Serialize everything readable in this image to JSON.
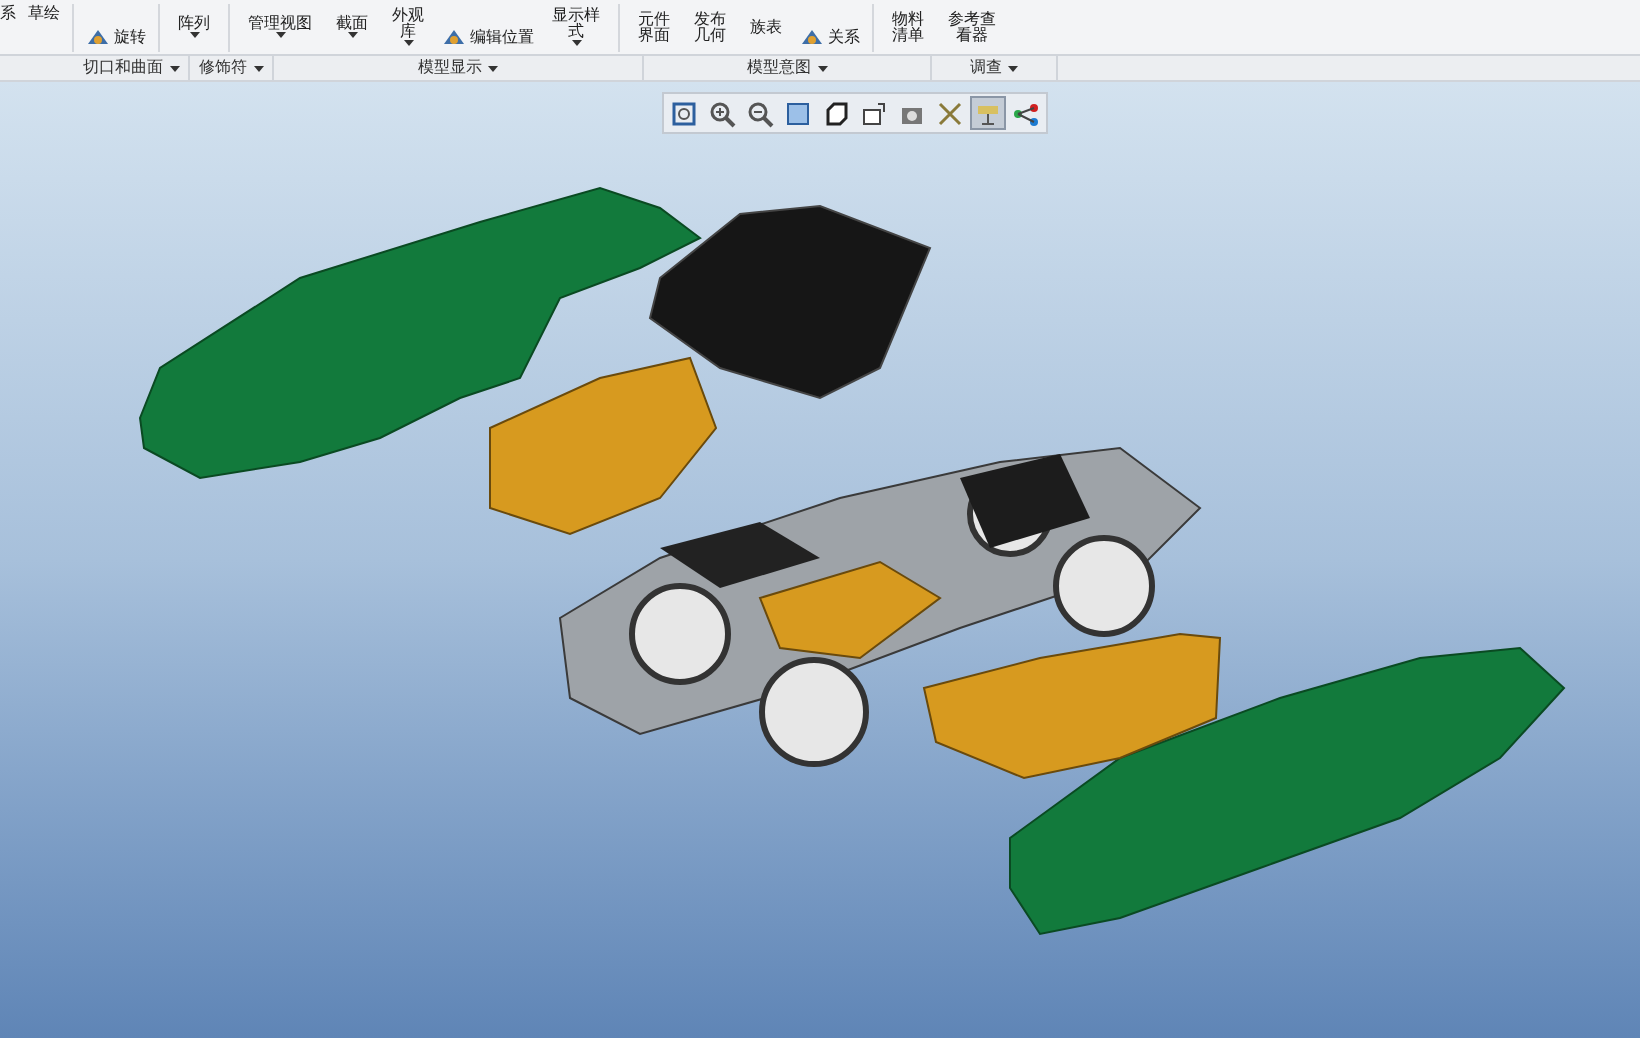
{
  "ribbon": {
    "items": [
      {
        "kind": "small",
        "label": "系",
        "dropdown": false
      },
      {
        "kind": "small",
        "label": "草绘",
        "dropdown": false
      },
      {
        "kind": "icon",
        "label": "旋转",
        "dropdown": false
      },
      {
        "kind": "big",
        "label": "阵列",
        "dropdown": true
      },
      {
        "kind": "big",
        "label": "管理视图",
        "dropdown": true
      },
      {
        "kind": "big",
        "label": "截面",
        "dropdown": true
      },
      {
        "kind": "stacked",
        "label": "外观库",
        "dropdown": true
      },
      {
        "kind": "icon",
        "label": "编辑位置",
        "dropdown": false
      },
      {
        "kind": "stacked",
        "label": "显示样式",
        "dropdown": true
      },
      {
        "kind": "stacked",
        "label": "元件界面",
        "dropdown": false
      },
      {
        "kind": "stacked",
        "label": "发布几何",
        "dropdown": false
      },
      {
        "kind": "big",
        "label": "族表",
        "dropdown": false
      },
      {
        "kind": "icon",
        "label": "关系",
        "dropdown": false
      },
      {
        "kind": "stacked",
        "label": "物料清单",
        "dropdown": false
      },
      {
        "kind": "stacked",
        "label": "参考查看器",
        "dropdown": false
      }
    ],
    "groups": [
      {
        "label": "切口和曲面"
      },
      {
        "label": "修饰符"
      },
      {
        "label": "模型显示"
      },
      {
        "label": "模型意图"
      },
      {
        "label": "调查"
      }
    ]
  },
  "view_toolbar": [
    {
      "selected": false
    },
    {
      "selected": false
    },
    {
      "selected": false
    },
    {
      "selected": false
    },
    {
      "selected": false
    },
    {
      "selected": false
    },
    {
      "selected": false
    },
    {
      "selected": false
    },
    {
      "selected": true
    },
    {
      "selected": false
    }
  ]
}
